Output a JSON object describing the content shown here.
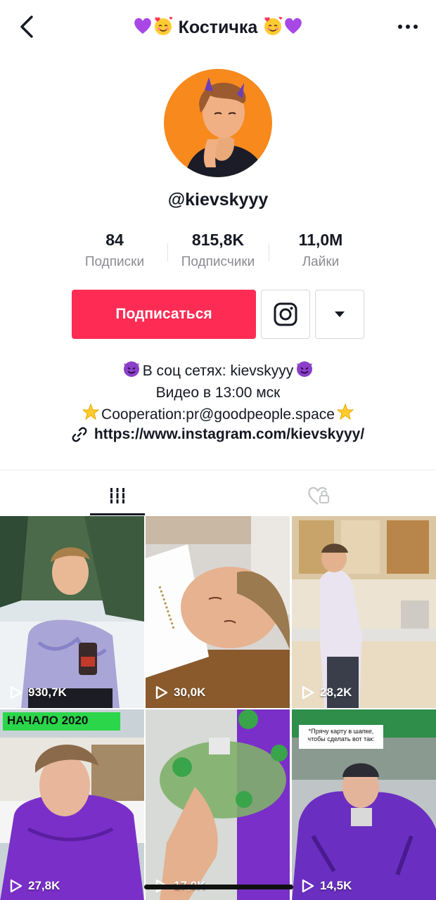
{
  "header": {
    "title_text": "Костичка",
    "back_label": "back",
    "more_label": "more"
  },
  "profile": {
    "username": "@kievskyyy"
  },
  "stats": [
    {
      "value": "84",
      "label": "Подписки"
    },
    {
      "value": "815,8K",
      "label": "Подписчики"
    },
    {
      "value": "11,0M",
      "label": "Лайки"
    }
  ],
  "actions": {
    "follow_label": "Подписаться"
  },
  "bio": {
    "line1": "В соц сетях: kievskyyy",
    "line2": "Видео в 13:00 мск",
    "line3": "Cooperation:pr@goodpeople.space",
    "link": "https://www.instagram.com/kievskyyy/"
  },
  "tabs": [
    {
      "name": "videos",
      "icon": "grid-icon",
      "active": true
    },
    {
      "name": "liked",
      "icon": "heart-lock-icon",
      "active": false
    }
  ],
  "videos": [
    {
      "views": "930,7K"
    },
    {
      "views": "30,0K"
    },
    {
      "views": "28,2K"
    },
    {
      "views": "27,8K",
      "overlay_text": "НАЧАЛО 2020"
    },
    {
      "views": "17,0K"
    },
    {
      "views": "14,5K",
      "overlay_text": "*Прячу карту в шапке, чтобы сделать вот так:"
    }
  ],
  "colors": {
    "accent": "#fe2c55",
    "text_primary": "#161823",
    "text_secondary": "#8a8b91"
  }
}
